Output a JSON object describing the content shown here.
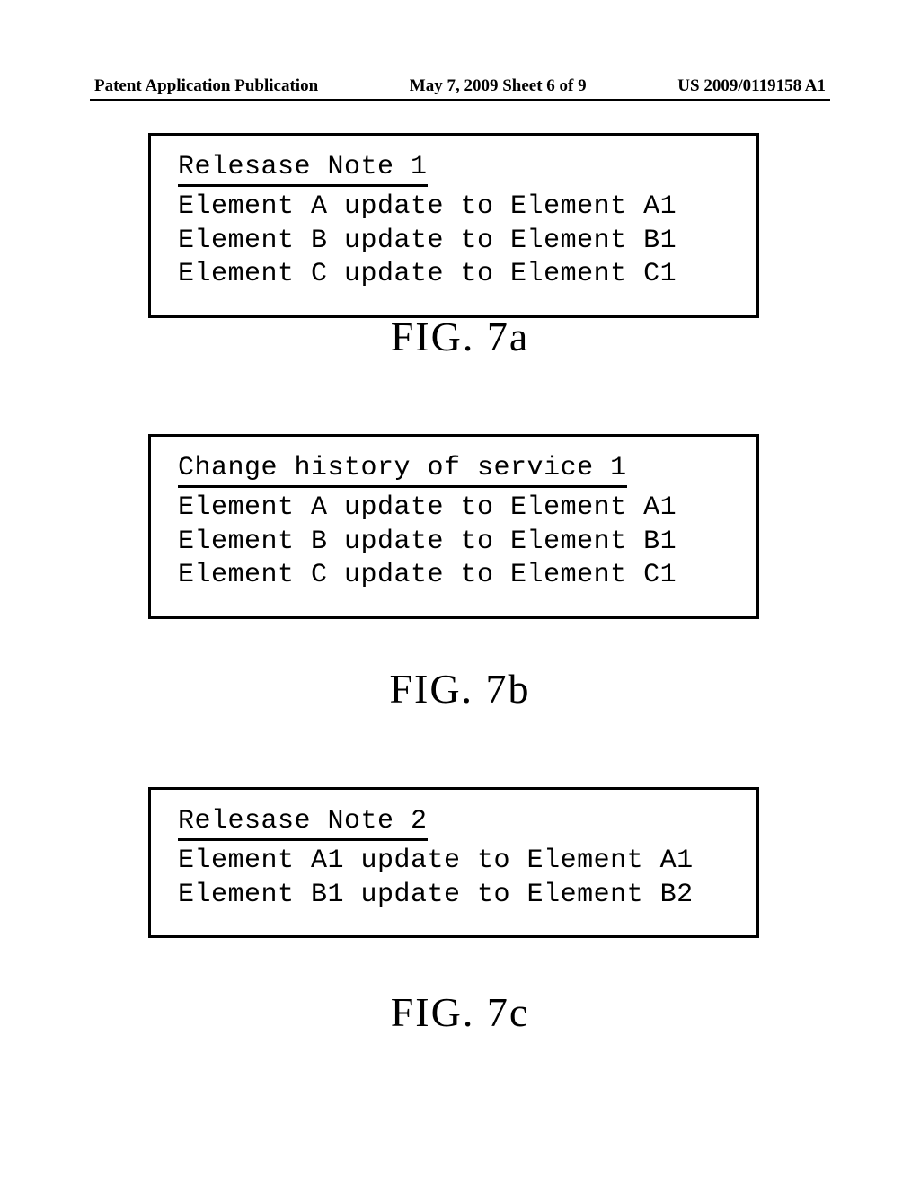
{
  "header": {
    "left": "Patent Application Publication",
    "center": "May 7, 2009  Sheet 6 of 9",
    "right": "US 2009/0119158 A1"
  },
  "figures": {
    "fig7a": {
      "title": "Relesase Note 1",
      "lines": [
        "Element A update to Element A1",
        "Element B update to Element B1",
        "Element C update to Element C1"
      ],
      "label": "FIG. 7a"
    },
    "fig7b": {
      "title": "Change history of service 1",
      "lines": [
        "Element A update to Element A1",
        "Element B update to Element B1",
        "Element C update to Element C1"
      ],
      "label": "FIG. 7b"
    },
    "fig7c": {
      "title": "Relesase Note 2",
      "lines": [
        "Element A1 update to Element A1",
        "Element B1 update to Element B2"
      ],
      "label": "FIG. 7c"
    }
  }
}
